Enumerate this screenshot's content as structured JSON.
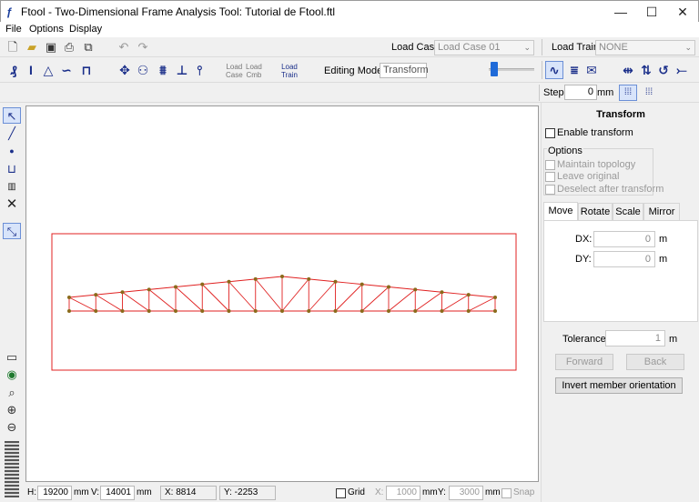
{
  "window": {
    "title": "Ftool - Two-Dimensional Frame Analysis Tool: Tutorial de Ftool.ftl",
    "app_icon": "ftool-logo-icon",
    "controls": [
      "—",
      "☐",
      "✕"
    ]
  },
  "menu": [
    "File",
    "Options",
    "Display"
  ],
  "toolbar1": {
    "icons": [
      "new-file-icon",
      "open-folder-icon",
      "save-icon",
      "print-icon",
      "copy-icon",
      "undo-icon",
      "redo-icon"
    ],
    "load_case_label": "Load Case:",
    "load_case_value": "Load Case 01",
    "load_train_label": "Load Train:",
    "load_train_value": "NONE"
  },
  "toolbar2": {
    "left_icons": [
      "model-icon",
      "section-icon",
      "triangle-icon",
      "curve-icon",
      "frame-icon",
      "node-icon",
      "bicycle-icon",
      "distributed-load-icon",
      "moment-icon",
      "thermometer-icon"
    ],
    "load_case_stack": [
      "Load",
      "Case"
    ],
    "load_comb_stack": [
      "Load",
      "Cmb"
    ],
    "load_train_stack": [
      "Load",
      "Train"
    ],
    "editing_mode_label": "Editing Mode:",
    "editing_mode_value": "Transform",
    "zoom_level": 0.05
  },
  "stepbar": {
    "step_label": "Step:",
    "step_value": "0",
    "step_unit": "mm"
  },
  "left_tools": [
    "select-arrow-icon",
    "draw-line-icon",
    "node-dot-icon",
    "dimension-icon",
    "ruler-icon",
    "delete-icon",
    "transform-icon",
    "display-icon",
    "globe-icon",
    "zoom-icon",
    "zoom-in-icon",
    "zoom-out-icon"
  ],
  "statusbar": {
    "h_label": "H:",
    "h_value": "19200",
    "h_unit": "mm",
    "v_label": "V:",
    "v_value": "14001",
    "v_unit": "mm",
    "x_coord": "X: 8814 mm",
    "y_coord": "Y: -2253 mm",
    "grid_label": "Grid",
    "grid_x_label": "X:",
    "grid_x_value": "1000",
    "grid_x_unit": "mm",
    "grid_y_label": "Y:",
    "grid_y_value": "3000",
    "grid_y_unit": "mm",
    "snap_label": "Snap"
  },
  "panel": {
    "heading": "Transform",
    "enable_label": "Enable transform",
    "options_label": "Options",
    "opt_maintain": "Maintain topology",
    "opt_leave": "Leave original",
    "opt_deselect": "Deselect after transform",
    "tabs": [
      "Move",
      "Rotate",
      "Scale",
      "Mirror"
    ],
    "dx_label": "DX:",
    "dx_value": "0",
    "dx_unit": "m",
    "dy_label": "DY:",
    "dy_value": "0",
    "dy_unit": "m",
    "tolerance_label": "Tolerance:",
    "tolerance_value": "1",
    "tolerance_unit": "m",
    "forward_label": "Forward",
    "back_label": "Back",
    "invert_label": "Invert member orientation"
  },
  "colors": {
    "truss": "#e02020",
    "node": "#8a6a1a",
    "accent": "#1b2f8a"
  }
}
